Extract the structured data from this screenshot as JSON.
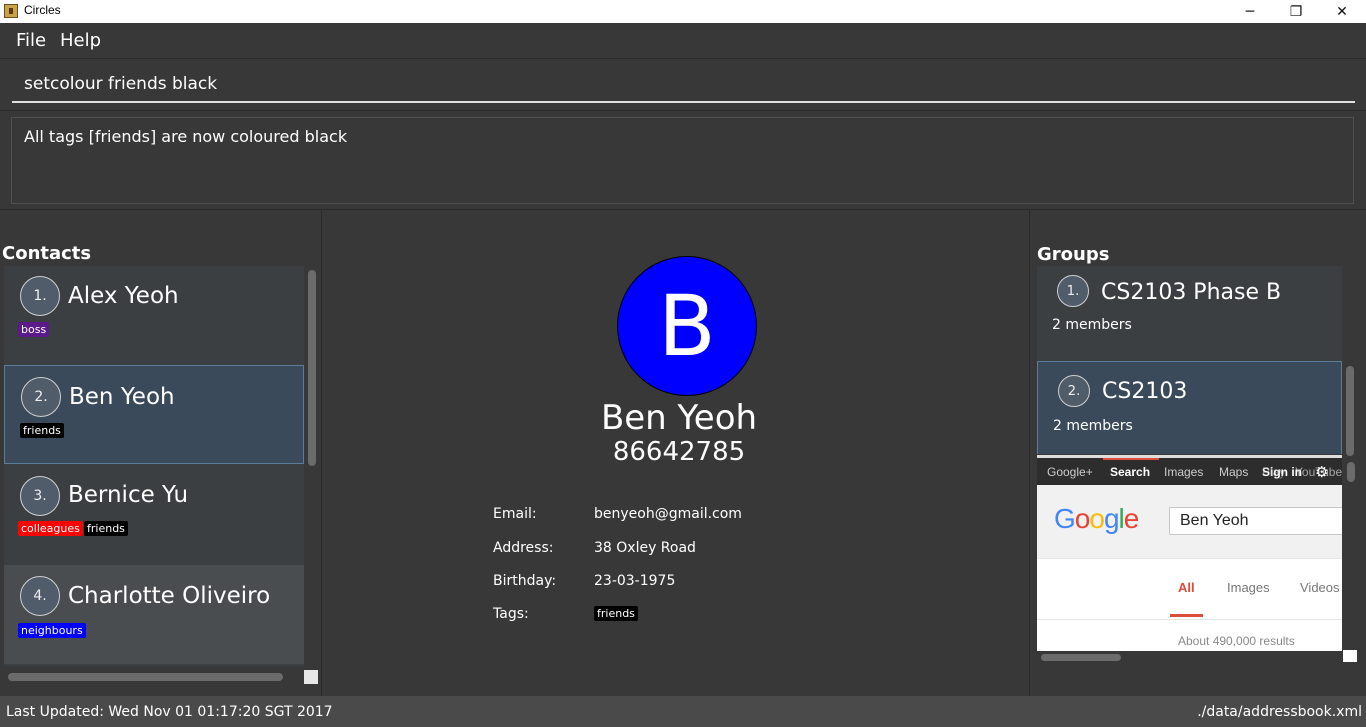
{
  "window": {
    "title": "Circles",
    "minimize": "─",
    "maximize": "❐",
    "close": "✕"
  },
  "menu": {
    "file": "File",
    "help": "Help"
  },
  "command": {
    "value": "setcolour friends black"
  },
  "result": {
    "text": "All tags [friends] are now coloured black"
  },
  "contacts": {
    "title": "Contacts",
    "items": [
      {
        "index": "1.",
        "name": "Alex Yeoh",
        "tags": [
          {
            "label": "boss",
            "color": "#5a1a8a"
          }
        ]
      },
      {
        "index": "2.",
        "name": "Ben Yeoh",
        "tags": [
          {
            "label": "friends",
            "color": "#000000"
          }
        ]
      },
      {
        "index": "3.",
        "name": "Bernice Yu",
        "tags": [
          {
            "label": "colleagues",
            "color": "#ff0000"
          },
          {
            "label": "friends",
            "color": "#000000"
          }
        ]
      },
      {
        "index": "4.",
        "name": "Charlotte Oliveiro",
        "tags": [
          {
            "label": "neighbours",
            "color": "#0000ff"
          }
        ]
      }
    ]
  },
  "person": {
    "initial": "B",
    "avatar_color": "#0000ff",
    "name": "Ben Yeoh",
    "phone": "86642785",
    "email_label": "Email:",
    "email": "benyeoh@gmail.com",
    "address_label": "Address:",
    "address": "38 Oxley Road",
    "birthday_label": "Birthday:",
    "birthday": "23-03-1975",
    "tags_label": "Tags:",
    "tags": [
      {
        "label": "friends",
        "color": "#000000"
      }
    ]
  },
  "groups": {
    "title": "Groups",
    "items": [
      {
        "index": "1.",
        "name": "CS2103 Phase B",
        "members": "2 members"
      },
      {
        "index": "2.",
        "name": "CS2103",
        "members": "2 members"
      }
    ]
  },
  "browser": {
    "bar_items": [
      "Google+",
      "Search",
      "Images",
      "Maps",
      "Sign in",
      "Play",
      "YouTube"
    ],
    "gear_icon": "⚙",
    "logo": "Google",
    "search_value": "Ben Yeoh",
    "tabs": [
      "All",
      "Images",
      "Videos"
    ],
    "results": "About 490,000 results"
  },
  "status": {
    "last_updated": "Last Updated: Wed Nov 01 01:17:20 SGT 2017",
    "path": "./data/addressbook.xml"
  }
}
